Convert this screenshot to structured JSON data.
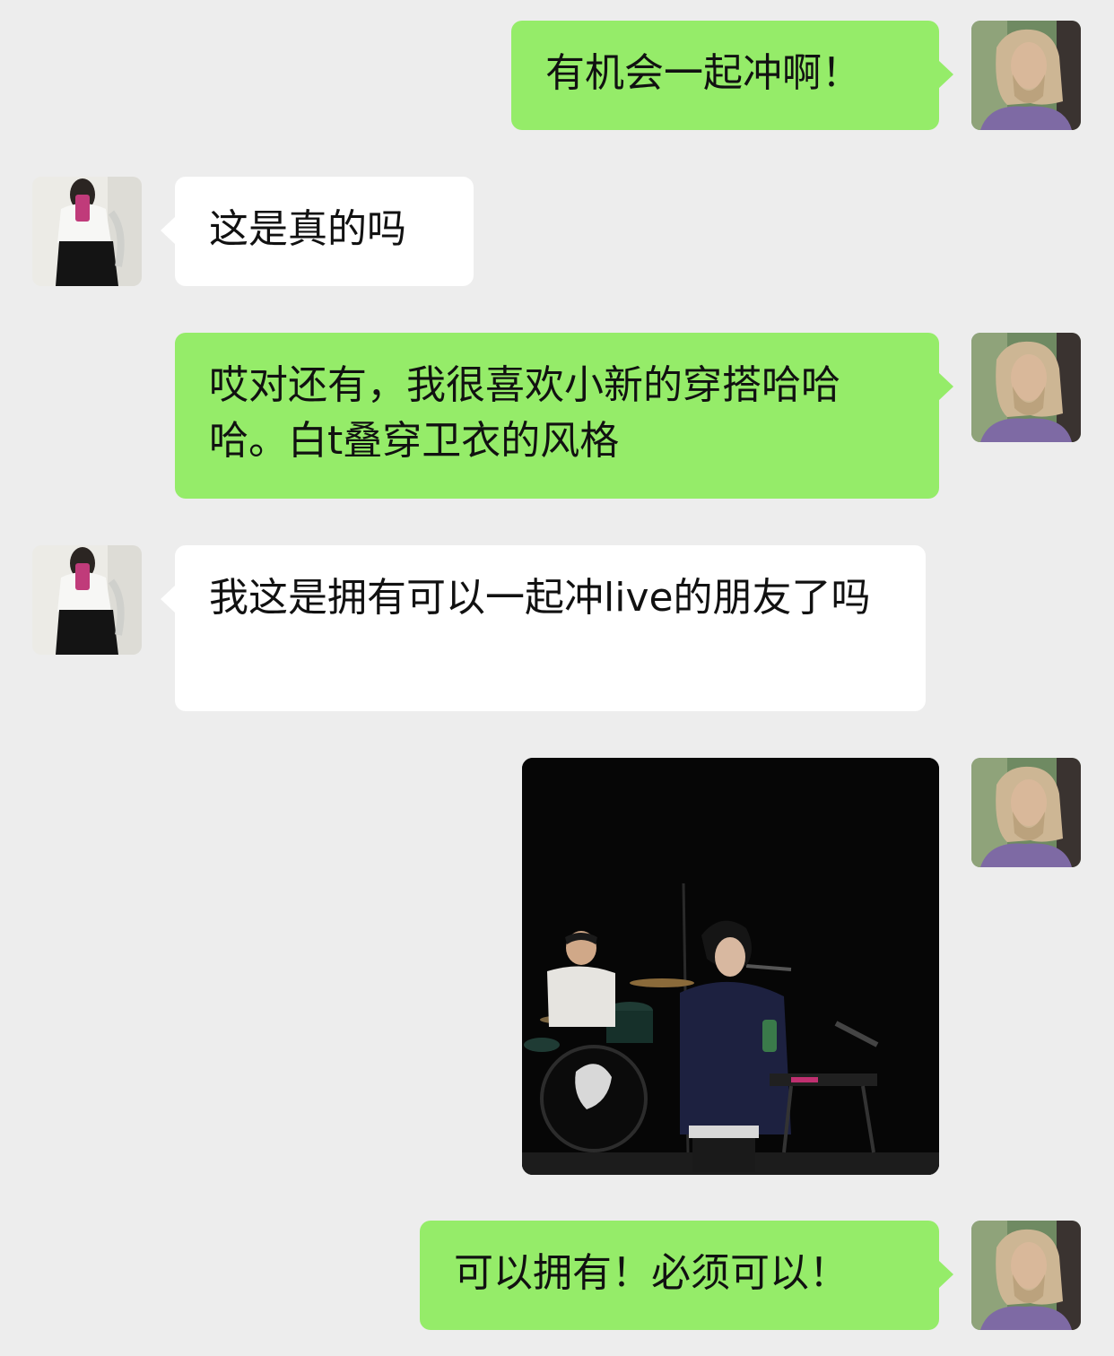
{
  "chat": {
    "messages": [
      {
        "sender": "me",
        "type": "text",
        "text": "有机会一起冲啊！"
      },
      {
        "sender": "contact",
        "type": "text",
        "text": "这是真的吗"
      },
      {
        "sender": "me",
        "type": "text",
        "text": "哎对还有，我很喜欢小新的穿搭哈哈哈。白t叠穿卫衣的风格"
      },
      {
        "sender": "contact",
        "type": "text",
        "text": "我这是拥有可以一起冲live的朋友了吗"
      },
      {
        "sender": "me",
        "type": "image",
        "text": ""
      },
      {
        "sender": "me",
        "type": "text",
        "text": "可以拥有！必须可以！"
      }
    ]
  },
  "colors": {
    "background": "#ededed",
    "sent_bubble": "#95ec69",
    "received_bubble": "#ffffff",
    "text": "#111111"
  }
}
